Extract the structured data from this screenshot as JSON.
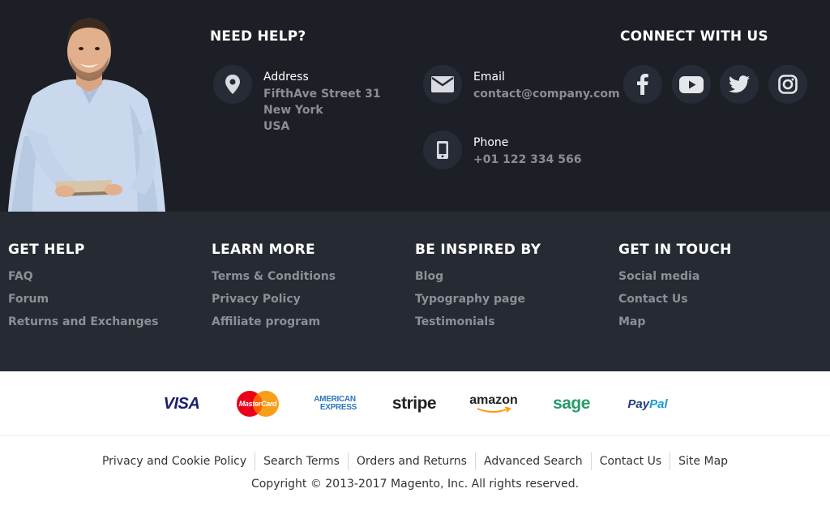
{
  "need_help": {
    "title": "NEED HELP?",
    "address": {
      "label": "Address",
      "lines": [
        "FifthAve Street 31",
        "New York",
        "USA"
      ]
    },
    "email": {
      "label": "Email",
      "value": "contact@company.com"
    },
    "phone": {
      "label": "Phone",
      "value": "+01 122 334 566"
    }
  },
  "connect": {
    "title": "CONNECT WITH US",
    "icons": [
      "facebook-icon",
      "youtube-icon",
      "twitter-icon",
      "instagram-icon"
    ]
  },
  "columns": [
    {
      "title": "GET HELP",
      "items": [
        "FAQ",
        "Forum",
        "Returns and Exchanges"
      ]
    },
    {
      "title": "LEARN MORE",
      "items": [
        "Terms & Conditions",
        "Privacy Policy",
        "Affiliate program"
      ]
    },
    {
      "title": "BE INSPIRED BY",
      "items": [
        "Blog",
        "Typography page",
        "Testimonials"
      ]
    },
    {
      "title": "GET IN TOUCH",
      "items": [
        "Social media",
        "Contact Us",
        "Map"
      ]
    }
  ],
  "payments": {
    "visa": "VISA",
    "mastercard": "MasterCard",
    "amex_top": "AMERICAN",
    "amex_bottom": "EXPRESS",
    "stripe": "stripe",
    "amazon": "amazon",
    "sage": "sage",
    "paypal_pay": "Pay",
    "paypal_pal": "Pal"
  },
  "footer_links": [
    "Privacy and Cookie Policy",
    "Search Terms",
    "Orders and Returns",
    "Advanced Search",
    "Contact Us",
    "Site Map"
  ],
  "copyright": "Copyright © 2013-2017 Magento, Inc. All rights reserved.",
  "colors": {
    "top_bg": "#1c1f26",
    "links_bg": "#262b33",
    "circle_bg": "#272b36",
    "muted_text": "#8b8f96"
  }
}
